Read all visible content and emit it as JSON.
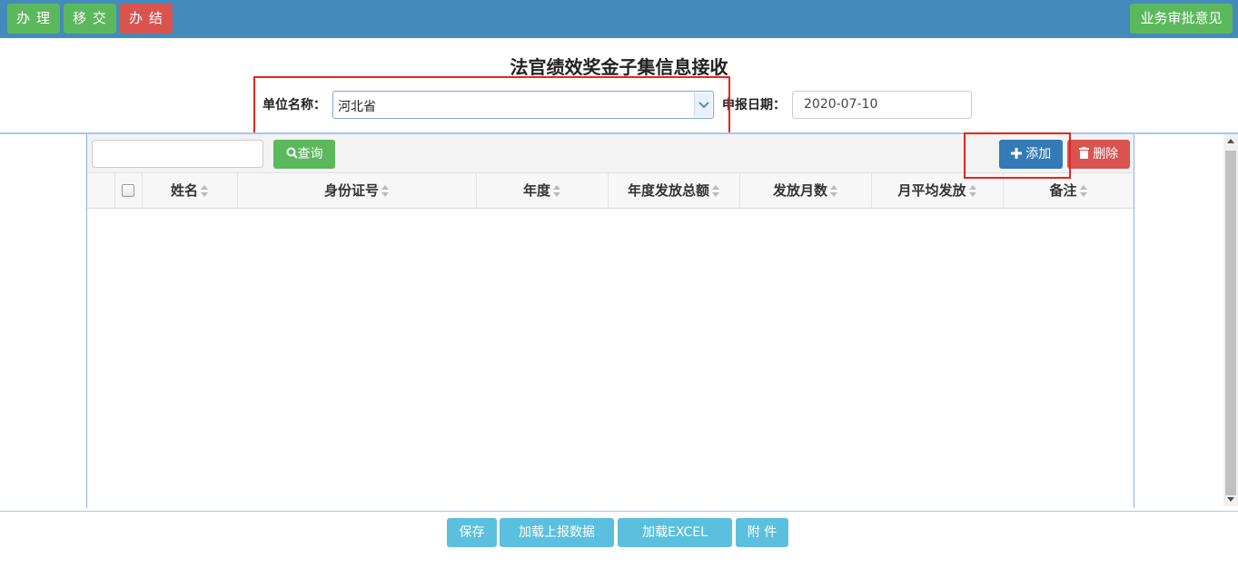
{
  "topbar": {
    "buttons": [
      "办 理",
      "移 交",
      "办 结"
    ],
    "opinion_button": "业务审批意见"
  },
  "form": {
    "title": "法官绩效奖金子集信息接收",
    "unit_label": "单位名称：",
    "unit_value": "河北省",
    "date_label": "申报日期：",
    "date_value": "2020-07-10"
  },
  "toolbar": {
    "search_placeholder": "",
    "query_button": "查询",
    "add_button": "添加",
    "delete_button": "删除"
  },
  "table": {
    "columns": [
      "姓名",
      "身份证号",
      "年度",
      "年度发放总额",
      "发放月数",
      "月平均发放",
      "备注"
    ],
    "rows": []
  },
  "footer": {
    "buttons": [
      "保存",
      "加载上报数据",
      "加载EXCEL",
      "附 件"
    ]
  },
  "colors": {
    "topbar": "#428bba",
    "success": "#5cb85c",
    "danger": "#d9534f",
    "primary": "#337ab7",
    "info": "#5bc0de",
    "highlight_box": "#e8231a"
  }
}
